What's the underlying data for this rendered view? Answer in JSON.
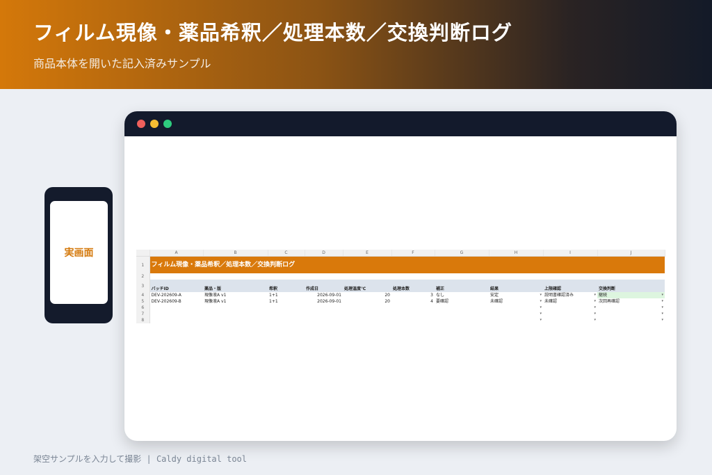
{
  "header": {
    "title": "フィルム現像・薬品希釈／処理本数／交換判断ログ",
    "subtitle": "商品本体を開いた記入済みサンプル"
  },
  "phone": {
    "label": "実画面"
  },
  "sheet": {
    "col_letters": [
      "A",
      "B",
      "C",
      "D",
      "E",
      "F",
      "G",
      "H",
      "I",
      "J"
    ],
    "row_numbers": [
      "1",
      "2",
      "3",
      "4",
      "5",
      "6",
      "7",
      "8"
    ],
    "title": "フィルム現像・薬品希釈／処理本数／交換判断ログ",
    "headers": [
      "バッチID",
      "薬品・版",
      "希釈",
      "作成日",
      "処理温度℃",
      "処理本数",
      "補正",
      "結果",
      "上限確認",
      "交換判断"
    ],
    "rows": [
      [
        "DEV-202609-A",
        "現像液A v1",
        "1+1",
        "2026-09-01",
        "20",
        "3",
        "なし",
        "安定",
        "説明書確認済み",
        "継続"
      ],
      [
        "DEV-202609-B",
        "現像液A v1",
        "1+1",
        "2026-09-01",
        "20",
        "4",
        "要確認",
        "未確認",
        "未確認",
        "次回再確認"
      ]
    ],
    "dropdown_arrow": "▾"
  },
  "footer": {
    "text": "架空サンプルを入力して撮影 | Caldy digital tool"
  },
  "colors": {
    "accent": "#D9790B",
    "header_row": "#DCE3EC",
    "success_cell": "#DDF5DF",
    "window_bar": "#131A2C"
  }
}
